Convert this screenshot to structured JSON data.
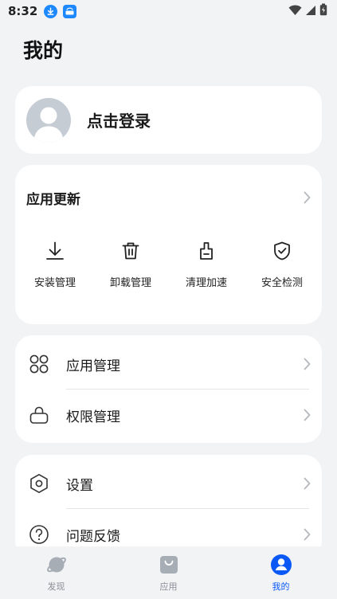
{
  "status_bar": {
    "time": "8:32",
    "notifications": [
      "download-icon",
      "app-store-icon"
    ],
    "system_icons": [
      "wifi-icon",
      "signal-icon",
      "battery-charging-icon"
    ]
  },
  "page": {
    "title": "我的"
  },
  "login": {
    "label": "点击登录"
  },
  "app_section": {
    "header": "应用更新",
    "tools": [
      {
        "label": "安装管理",
        "icon": "install-download-icon"
      },
      {
        "label": "卸载管理",
        "icon": "trash-icon"
      },
      {
        "label": "清理加速",
        "icon": "brush-clean-icon"
      },
      {
        "label": "安全检测",
        "icon": "shield-check-icon"
      }
    ]
  },
  "management": {
    "items": [
      {
        "label": "应用管理",
        "icon": "apps-grid-icon"
      },
      {
        "label": "权限管理",
        "icon": "lock-icon"
      }
    ]
  },
  "settings": {
    "items": [
      {
        "label": "设置",
        "icon": "settings-hexagon-icon"
      },
      {
        "label": "问题反馈",
        "icon": "question-icon"
      }
    ]
  },
  "bottom_nav": {
    "active": "我的",
    "items": [
      {
        "label": "发现",
        "icon": "discover-planet-icon"
      },
      {
        "label": "应用",
        "icon": "shopping-bag-icon"
      },
      {
        "label": "我的",
        "icon": "profile-icon"
      }
    ]
  },
  "colors": {
    "background": "#f1f3f5",
    "card": "#ffffff",
    "accent": "#0a59f7",
    "avatar": "#c5ccd4",
    "notification_icon": "#1e88ff"
  }
}
